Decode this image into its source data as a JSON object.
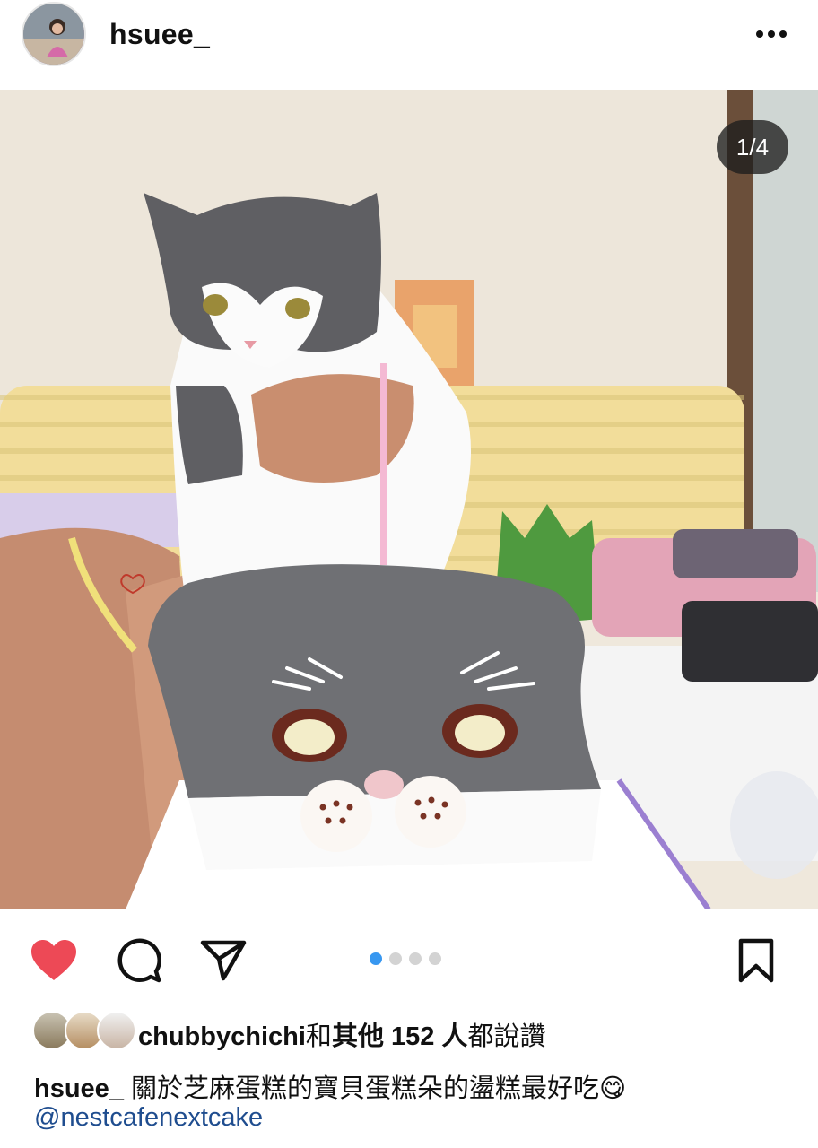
{
  "post": {
    "username": "hsuee_",
    "image_counter": "1/4",
    "carousel": {
      "total": 4,
      "active_index": 0
    }
  },
  "header_icons": {
    "more": "more-horizontal-icon"
  },
  "action_icons": {
    "like": "heart-icon",
    "comment": "comment-icon",
    "share": "paper-plane-icon",
    "save": "bookmark-icon"
  },
  "likes": {
    "first_liker": "chubbychichi",
    "connector": "和",
    "others": "其他 152 人",
    "suffix": "都說讚"
  },
  "caption": {
    "username": "hsuee_",
    "text": "關於芝麻蛋糕的寶貝蛋糕朵的盪糕最好吃",
    "emoji": "😋",
    "mention": "@nestcafenextcake"
  },
  "colors": {
    "like": "#ed4956",
    "link": "#1f4d8f",
    "carousel_active": "#3797f0"
  }
}
